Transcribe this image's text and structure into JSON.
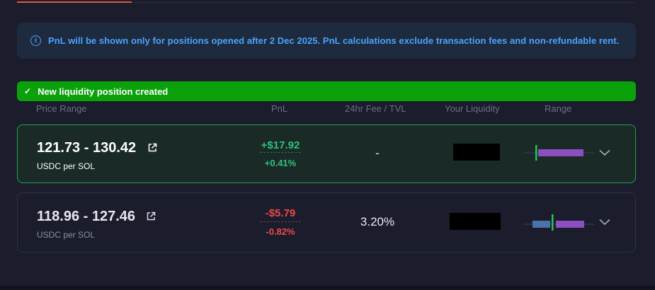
{
  "info": {
    "text": "PnL will be shown only for positions opened after 2 Dec 2025. PnL calculations exclude transaction fees and non-refundable rent.",
    "icon": "info-icon"
  },
  "toast": {
    "text": "New liquidity position created",
    "icon": "check-icon"
  },
  "columns": {
    "price_range": "Price Range",
    "pnl": "PnL",
    "fee_tvl": "24hr Fee / TVL",
    "your_liquidity": "Your Liquidity",
    "range": "Range"
  },
  "positions": [
    {
      "range": "121.73 - 130.42",
      "pair": "USDC per SOL",
      "pnl_value": "+$17.92",
      "pnl_pct": "+0.41%",
      "fee_tvl": "-",
      "pnl_color": "#2ec27e"
    },
    {
      "range": "118.96 - 127.46",
      "pair": "USDC per SOL",
      "pnl_value": "-$5.79",
      "pnl_pct": "-0.82%",
      "fee_tvl": "3.20%",
      "pnl_color": "#f04848"
    }
  ],
  "colors": {
    "accent": "#e4573c",
    "info": "#4aa3ff",
    "success": "#0aa10a",
    "range_purple": "#8c4fbf",
    "range_blue": "#4a73a8",
    "range_marker": "#22c55e"
  }
}
